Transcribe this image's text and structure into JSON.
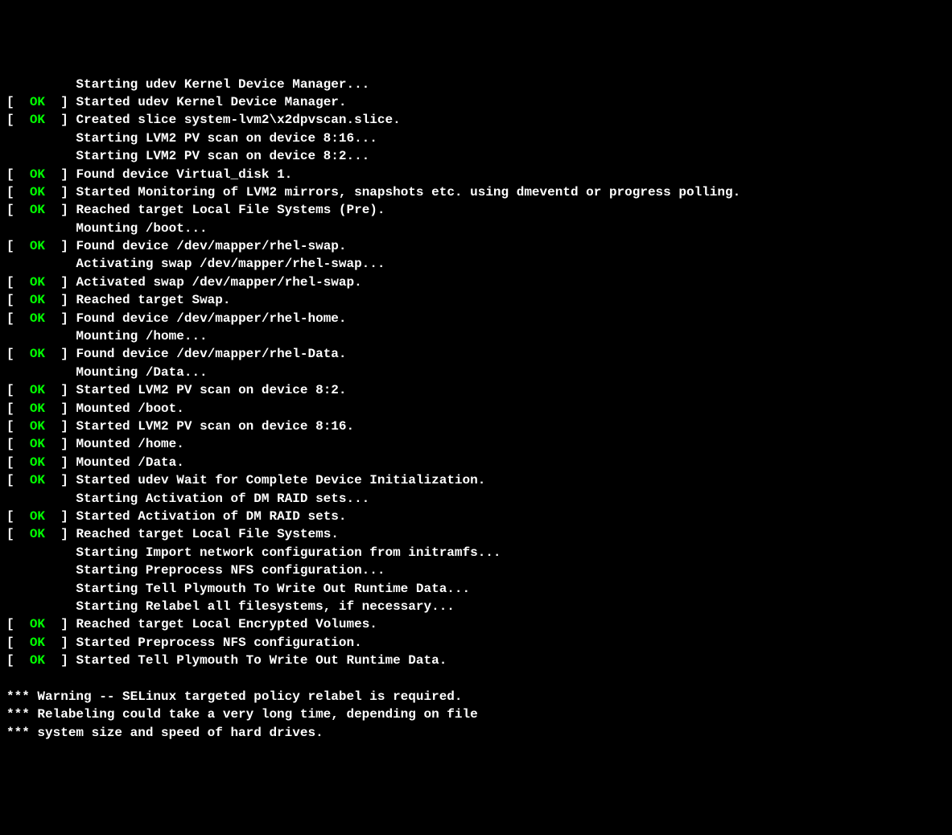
{
  "status_label": "OK",
  "lines": [
    {
      "type": "indent",
      "text": "         Starting udev Kernel Device Manager..."
    },
    {
      "type": "status",
      "text": "Started udev Kernel Device Manager."
    },
    {
      "type": "status",
      "text": "Created slice system-lvm2\\x2dpvscan.slice."
    },
    {
      "type": "indent",
      "text": "         Starting LVM2 PV scan on device 8:16..."
    },
    {
      "type": "indent",
      "text": "         Starting LVM2 PV scan on device 8:2..."
    },
    {
      "type": "status",
      "text": "Found device Virtual_disk 1."
    },
    {
      "type": "status",
      "text": "Started Monitoring of LVM2 mirrors, snapshots etc. using dmeventd or progress polling."
    },
    {
      "type": "status",
      "text": "Reached target Local File Systems (Pre)."
    },
    {
      "type": "indent",
      "text": "         Mounting /boot..."
    },
    {
      "type": "status",
      "text": "Found device /dev/mapper/rhel-swap."
    },
    {
      "type": "indent",
      "text": "         Activating swap /dev/mapper/rhel-swap..."
    },
    {
      "type": "status",
      "text": "Activated swap /dev/mapper/rhel-swap."
    },
    {
      "type": "status",
      "text": "Reached target Swap."
    },
    {
      "type": "status",
      "text": "Found device /dev/mapper/rhel-home."
    },
    {
      "type": "indent",
      "text": "         Mounting /home..."
    },
    {
      "type": "status",
      "text": "Found device /dev/mapper/rhel-Data."
    },
    {
      "type": "indent",
      "text": "         Mounting /Data..."
    },
    {
      "type": "status",
      "text": "Started LVM2 PV scan on device 8:2."
    },
    {
      "type": "status",
      "text": "Mounted /boot."
    },
    {
      "type": "status",
      "text": "Started LVM2 PV scan on device 8:16."
    },
    {
      "type": "status",
      "text": "Mounted /home."
    },
    {
      "type": "status",
      "text": "Mounted /Data."
    },
    {
      "type": "status",
      "text": "Started udev Wait for Complete Device Initialization."
    },
    {
      "type": "indent",
      "text": "         Starting Activation of DM RAID sets..."
    },
    {
      "type": "status",
      "text": "Started Activation of DM RAID sets."
    },
    {
      "type": "status",
      "text": "Reached target Local File Systems."
    },
    {
      "type": "indent",
      "text": "         Starting Import network configuration from initramfs..."
    },
    {
      "type": "indent",
      "text": "         Starting Preprocess NFS configuration..."
    },
    {
      "type": "indent",
      "text": "         Starting Tell Plymouth To Write Out Runtime Data..."
    },
    {
      "type": "indent",
      "text": "         Starting Relabel all filesystems, if necessary..."
    },
    {
      "type": "status",
      "text": "Reached target Local Encrypted Volumes."
    },
    {
      "type": "status",
      "text": "Started Preprocess NFS configuration."
    },
    {
      "type": "status",
      "text": "Started Tell Plymouth To Write Out Runtime Data."
    },
    {
      "type": "blank",
      "text": ""
    },
    {
      "type": "plain",
      "text": "*** Warning -- SELinux targeted policy relabel is required."
    },
    {
      "type": "plain",
      "text": "*** Relabeling could take a very long time, depending on file"
    },
    {
      "type": "plain",
      "text": "*** system size and speed of hard drives."
    }
  ],
  "bracket_open": "[",
  "bracket_close": "]"
}
